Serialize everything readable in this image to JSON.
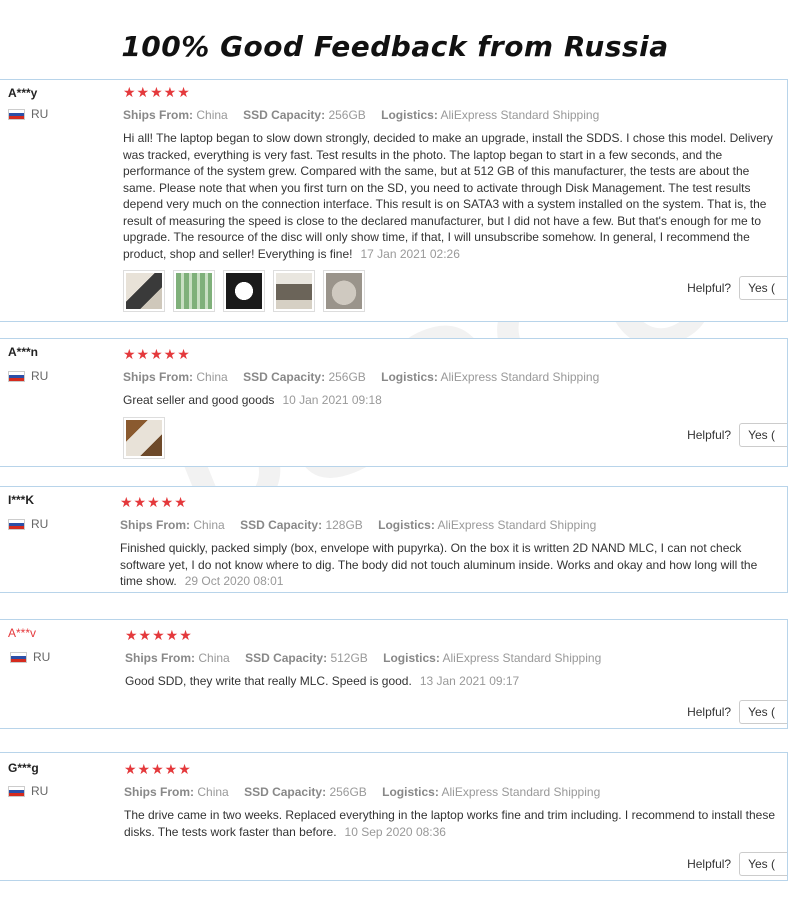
{
  "banner": {
    "title": "100% Good Feedback from Russia"
  },
  "watermark": {
    "text": "DSCCO",
    "subtext": "connect digital world!"
  },
  "colors": {
    "star": "#e4393c",
    "border": "#b8d4ea",
    "muted": "#999999"
  },
  "labels": {
    "ships_from": "Ships From:",
    "ssd_capacity": "SSD Capacity:",
    "logistics": "Logistics:",
    "helpful": "Helpful?",
    "yes": "Yes ("
  },
  "reviews": [
    {
      "user": "A***y",
      "country": "RU",
      "stars": "★★★★★",
      "ships_from": "China",
      "capacity": "256GB",
      "logistics": "AliExpress Standard Shipping",
      "text": "Hi all! The laptop began to slow down strongly, decided to make an upgrade, install the SDDS. I chose this model. Delivery was tracked, everything is very fast. Test results in the photo. The laptop began to start in a few seconds, and the performance of the system grew. Compared with the same, but at 512 GB of this manufacturer, the tests are about the same. Please note that when you first turn on the SD, you need to activate through Disk Management. The test results depend very much on the connection interface. This result is on SATA3 with a system installed on the system. That is, the result of measuring the speed is close to the declared manufacturer, but I did not have a few. But that's enough for me to upgrade. The resource of the disc will only show time, if that, I will unsubscribe somehow. In general, I recommend the product, shop and seller! Everything is fine!",
      "date": "17 Jan 2021 02:26"
    },
    {
      "user": "A***n",
      "country": "RU",
      "stars": "★★★★★",
      "ships_from": "China",
      "capacity": "256GB",
      "logistics": "AliExpress Standard Shipping",
      "text": "Great seller and good goods",
      "date": "10 Jan 2021 09:18"
    },
    {
      "user": "I***K",
      "country": "RU",
      "stars": "★★★★★",
      "ships_from": "China",
      "capacity": "128GB",
      "logistics": "AliExpress Standard Shipping",
      "text": "Finished quickly, packed simply (box, envelope with pupyrka). On the box it is written 2D NAND MLC, I can not check software yet, I do not know where to dig. The body did not touch aluminum inside. Works and okay and how long will the time show.",
      "date": "29 Oct 2020 08:01"
    },
    {
      "user": "A***v",
      "country": "RU",
      "stars": "★★★★★",
      "ships_from": "China",
      "capacity": "512GB",
      "logistics": "AliExpress Standard Shipping",
      "text": "Good SDD, they write that really MLC. Speed is good.",
      "date": "13 Jan 2021 09:17"
    },
    {
      "user": "G***g",
      "country": "RU",
      "stars": "★★★★★",
      "ships_from": "China",
      "capacity": "256GB",
      "logistics": "AliExpress Standard Shipping",
      "text": "The drive came in two weeks. Replaced everything in the laptop works fine and trim including. I recommend to install these disks. The tests work faster than before.",
      "date": "10 Sep 2020 08:36"
    }
  ]
}
